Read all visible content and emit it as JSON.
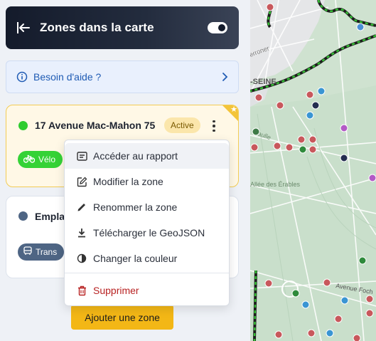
{
  "header": {
    "title": "Zones dans la carte"
  },
  "help": {
    "label": "Besoin d'aide ?"
  },
  "zones": [
    {
      "name": "17 Avenue Mac-Mahon 75",
      "status": "Active",
      "mode": "Vélo",
      "color": "#2ecc2e"
    },
    {
      "name": "Empla",
      "mode": "Trans",
      "color": "#4e6584"
    }
  ],
  "menu": {
    "items": [
      {
        "label": "Accéder au rapport",
        "icon": "report-icon"
      },
      {
        "label": "Modifier la zone",
        "icon": "edit-icon"
      },
      {
        "label": "Renommer la zone",
        "icon": "pencil-icon"
      },
      {
        "label": "Télécharger le GeoJSON",
        "icon": "download-icon"
      },
      {
        "label": "Changer la couleur",
        "icon": "contrast-icon"
      }
    ],
    "danger": {
      "label": "Supprimer",
      "icon": "trash-icon"
    }
  },
  "add_button": {
    "label": "Ajouter une zone"
  },
  "map": {
    "labels": [
      "erroner",
      "-SEINE",
      "Avenue Foch",
      "Allée des Érables",
      "aulle"
    ]
  },
  "colors": {
    "accent": "#f3b716",
    "header_bg": "#141b2b",
    "help_text": "#1f5bb4",
    "danger": "#b82222"
  }
}
